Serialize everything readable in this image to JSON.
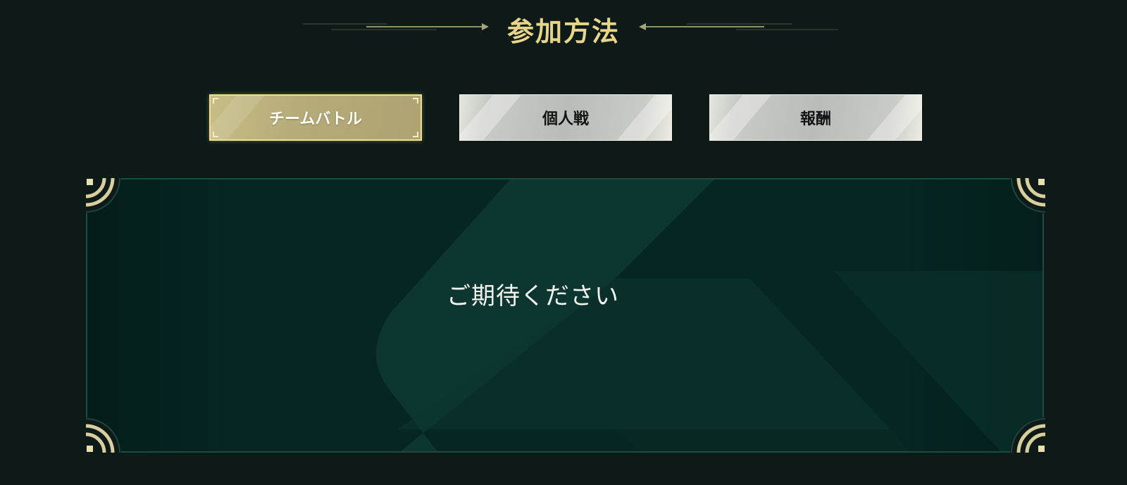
{
  "header": {
    "title": "参加方法"
  },
  "tabs": [
    {
      "label": "チームバトル",
      "active": true
    },
    {
      "label": "個人戦",
      "active": false
    },
    {
      "label": "報酬",
      "active": false
    }
  ],
  "panel": {
    "message": "ご期待ください"
  },
  "colors": {
    "background": "#0d1a18",
    "title_gold": "#e8d58a",
    "active_tab": "#b6ac78",
    "inactive_tab": "#babcb9",
    "panel": "#052622",
    "panel_border": "#1d4a43"
  },
  "icons": {
    "header_left": "arrow-right-line-ornament-icon",
    "header_right": "arrow-left-line-ornament-icon",
    "panel_corners": "concentric-arc-corner-icon"
  }
}
